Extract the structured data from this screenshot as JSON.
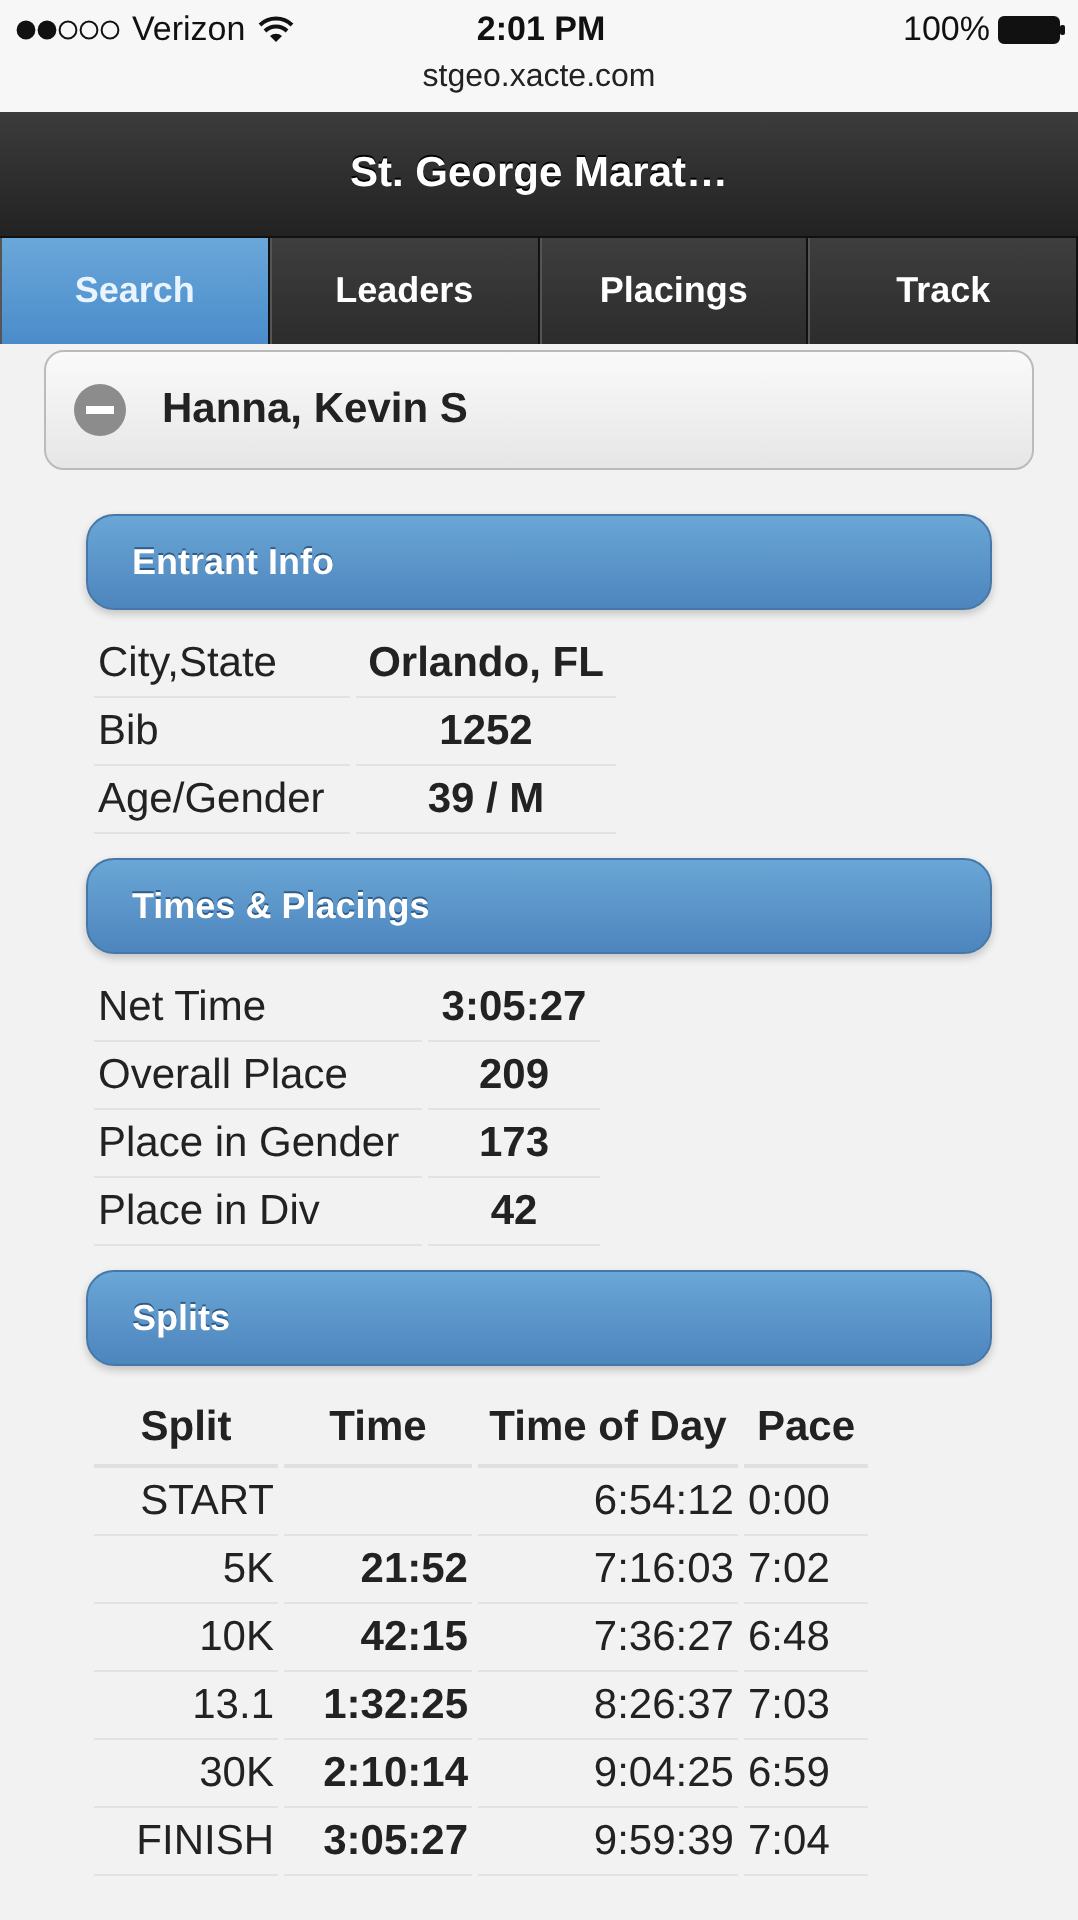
{
  "status_bar": {
    "carrier": "Verizon",
    "time": "2:01 PM",
    "battery": "100%"
  },
  "url": "stgeo.xacte.com",
  "header": {
    "title": "St. George Marat…"
  },
  "tabs": [
    {
      "label": "Search",
      "selected": true
    },
    {
      "label": "Leaders",
      "selected": false
    },
    {
      "label": "Placings",
      "selected": false
    },
    {
      "label": "Track",
      "selected": false
    }
  ],
  "entrant": {
    "name": "Hanna, Kevin S",
    "expanded": true
  },
  "entrant_info": {
    "title": "Entrant Info",
    "rows": [
      {
        "label": "City,State",
        "value": "Orlando, FL"
      },
      {
        "label": "Bib",
        "value": "1252"
      },
      {
        "label": "Age/Gender",
        "value": "39 / M"
      }
    ]
  },
  "times_placings": {
    "title": "Times & Placings",
    "rows": [
      {
        "label": "Net Time",
        "value": "3:05:27"
      },
      {
        "label": "Overall Place",
        "value": "209"
      },
      {
        "label": "Place in Gender",
        "value": "173"
      },
      {
        "label": "Place in Div",
        "value": "42"
      }
    ]
  },
  "splits": {
    "title": "Splits",
    "columns": [
      "Split",
      "Time",
      "Time of Day",
      "Pace"
    ],
    "rows": [
      {
        "split": "START",
        "time_of_day": "6:54:12",
        "pace": "0:00"
      },
      {
        "split": "5K",
        "time": "21:52",
        "time_of_day": "7:16:03",
        "pace": "7:02"
      },
      {
        "split": "10K",
        "time": "42:15",
        "time_of_day": "7:36:27",
        "pace": "6:48"
      },
      {
        "split": "13.1",
        "time": "1:32:25",
        "time_of_day": "8:26:37",
        "pace": "7:03"
      },
      {
        "split": "30K",
        "time": "2:10:14",
        "time_of_day": "9:04:25",
        "pace": "6:59"
      },
      {
        "split": "FINISH",
        "time": "3:05:27",
        "time_of_day": "9:59:39",
        "pace": "7:04"
      }
    ]
  }
}
